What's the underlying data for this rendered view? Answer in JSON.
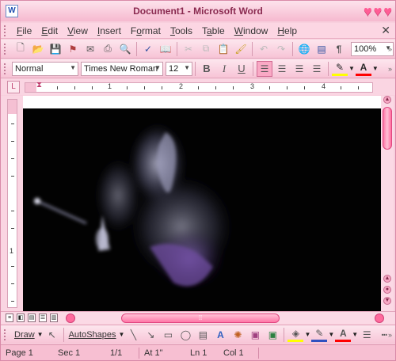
{
  "window": {
    "title": "Document1 - Microsoft Word",
    "app_icon": "W"
  },
  "menu": [
    "File",
    "Edit",
    "View",
    "Insert",
    "Format",
    "Tools",
    "Table",
    "Window",
    "Help"
  ],
  "menu_accel": [
    "F",
    "E",
    "V",
    "I",
    "o",
    "T",
    "a",
    "W",
    "H"
  ],
  "standard_toolbar": {
    "zoom": "100%"
  },
  "formatting_toolbar": {
    "style": "Normal",
    "font": "Times New Roman",
    "size": "12",
    "bold": "B",
    "italic": "I",
    "underline": "U"
  },
  "ruler": {
    "labels": [
      "1",
      "2",
      "3",
      "4"
    ],
    "vlabels": [
      "1"
    ]
  },
  "drawing_toolbar": {
    "draw": "Draw",
    "autoshapes": "AutoShapes"
  },
  "status": {
    "page": "Page 1",
    "section": "Sec 1",
    "pages": "1/1",
    "at": "At 1\"",
    "line": "Ln 1",
    "col": "Col 1"
  },
  "colors": {
    "accent": "#ff6b9d",
    "chrome": "#f8cfdd",
    "document_bg": "#020202"
  },
  "icons": [
    "new-icon",
    "open-icon",
    "save-icon",
    "permission-icon",
    "email-icon",
    "print-icon",
    "print-preview-icon",
    "spelling-icon",
    "research-icon",
    "cut-icon",
    "copy-icon",
    "paste-icon",
    "format-painter-icon",
    "undo-icon",
    "redo-icon",
    "hyperlink-icon",
    "document-map-icon",
    "show-formatting-icon"
  ]
}
